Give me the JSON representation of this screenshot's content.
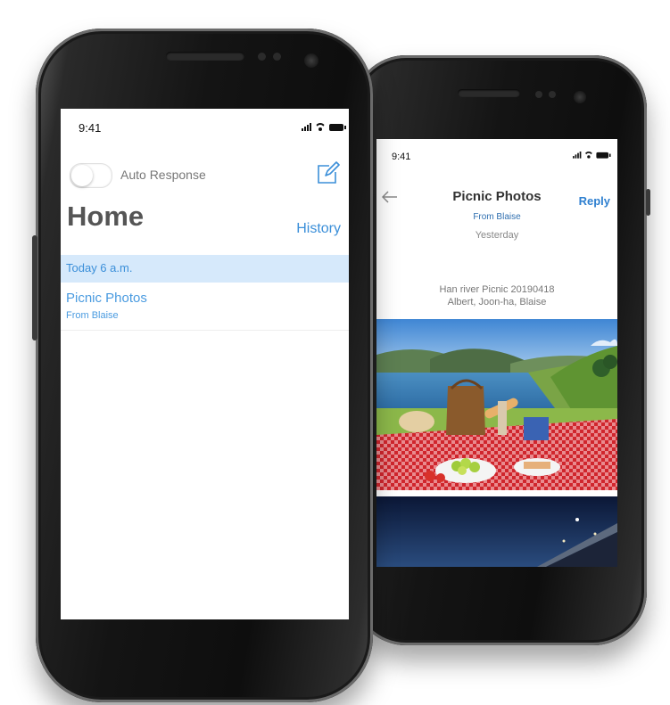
{
  "front_screen": {
    "status_time": "9:41",
    "auto_response_label": "Auto Response",
    "auto_response_on": false,
    "title": "Home",
    "history_label": "History",
    "section_header": "Today 6 a.m.",
    "messages": [
      {
        "subject": "Picnic Photos",
        "from": "From Blaise"
      }
    ],
    "icons": [
      "compose-icon",
      "signal-icon",
      "wifi-icon",
      "battery-icon"
    ]
  },
  "back_screen": {
    "status_time": "9:41",
    "title": "Picnic Photos",
    "reply_label": "Reply",
    "from": "From Blaise",
    "date": "Yesterday",
    "caption_line1": "Han river Picnic 20190418",
    "caption_line2": "Albert, Joon-ha, Blaise",
    "icons": [
      "back-arrow-icon",
      "signal-icon",
      "wifi-icon",
      "battery-icon"
    ]
  },
  "colors": {
    "accent": "#3b8fd9",
    "section_bg": "#d6e9fb",
    "title_gray": "#555555",
    "device_body": "#141414"
  }
}
